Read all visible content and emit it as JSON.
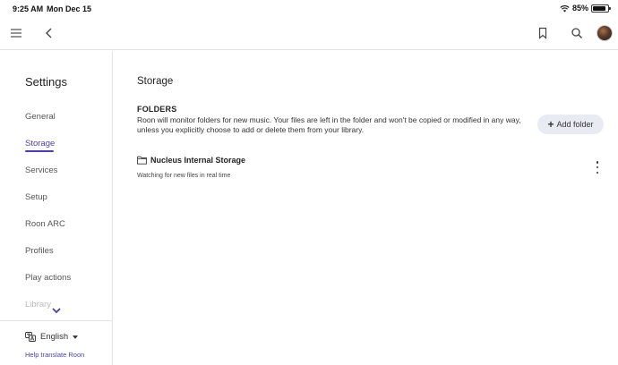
{
  "status_bar": {
    "time": "9:25 AM",
    "date": "Mon Dec 15",
    "battery": "85%",
    "battery_level": 0.85
  },
  "top_bar": {
    "icons": [
      "menu-icon",
      "back-chevron-icon",
      "bookmark-icon",
      "search-icon",
      "avatar"
    ]
  },
  "sidebar": {
    "title": "Settings",
    "items": [
      {
        "label": "General",
        "active": false
      },
      {
        "label": "Storage",
        "active": true
      },
      {
        "label": "Services",
        "active": false
      },
      {
        "label": "Setup",
        "active": false
      },
      {
        "label": "Roon ARC",
        "active": false
      },
      {
        "label": "Profiles",
        "active": false
      },
      {
        "label": "Play actions",
        "active": false
      },
      {
        "label": "Library",
        "active": false
      }
    ],
    "language": "English",
    "translate_link": "Help translate Roon"
  },
  "main": {
    "page_title": "Storage",
    "folders": {
      "title": "FOLDERS",
      "description": "Roon will monitor folders for new music. Your files are left in the folder and won't be copied or modified in any way, unless you explicitly choose to add or delete them from your library.",
      "add_button": "Add folder"
    },
    "storage_item": {
      "name": "Nucleus Internal Storage",
      "status": "Watching for new files in real time"
    }
  },
  "colors": {
    "accent": "#4b3fa6",
    "button_bg": "#e9ebf2",
    "divider": "#e4e4e4"
  }
}
